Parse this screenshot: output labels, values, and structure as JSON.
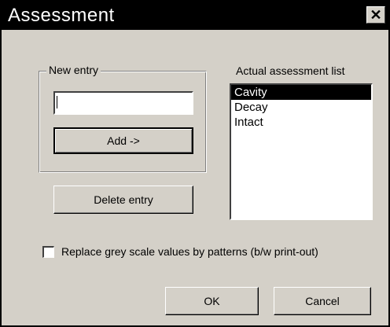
{
  "window": {
    "title": "Assessment",
    "close_glyph": "✕",
    "close_icon": "close-icon"
  },
  "new_entry": {
    "group_label": "New entry",
    "input_value": "",
    "add_label": "Add ->"
  },
  "delete_label": "Delete entry",
  "assessment_list": {
    "label": "Actual assessment list",
    "items": [
      "Cavity",
      "Decay",
      "Intact"
    ],
    "selected_index": 0
  },
  "options": {
    "patterns_label": "Replace grey scale values by patterns (b/w print-out)",
    "patterns_checked": false
  },
  "footer": {
    "ok_label": "OK",
    "cancel_label": "Cancel"
  },
  "colors": {
    "titlebar": "#000000",
    "dialog_bg": "#d4d0c8",
    "selection": "#000000"
  }
}
